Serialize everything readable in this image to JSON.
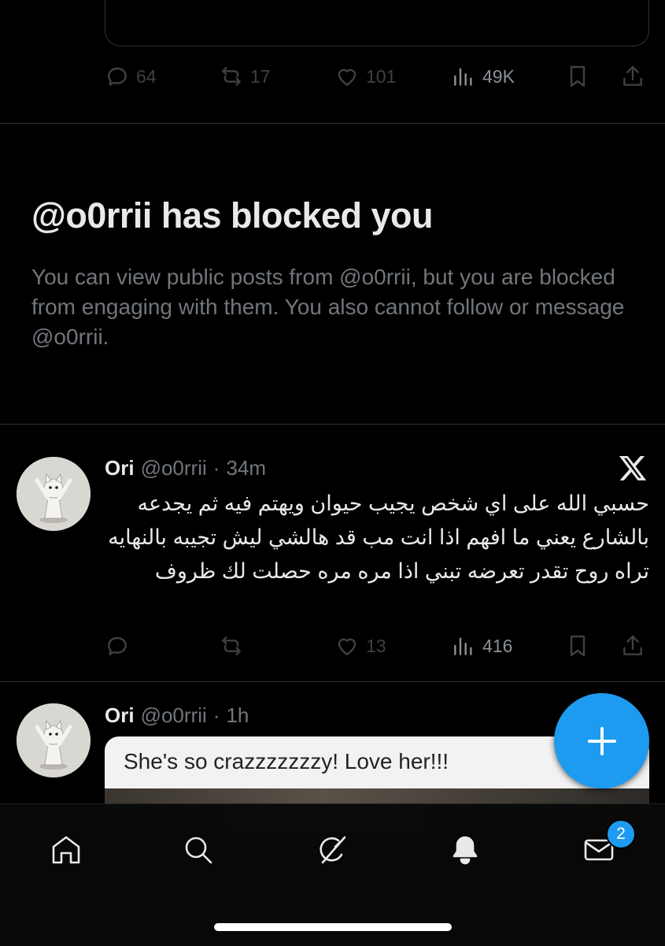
{
  "top_post": {
    "actions": {
      "reply": "64",
      "repost": "17",
      "like": "101",
      "views": "49K"
    }
  },
  "blocked": {
    "title": "@o0rrii has blocked you",
    "message": "You can view public posts from @o0rrii, but you are blocked from engaging with them. You also cannot follow or message @o0rrii."
  },
  "posts": [
    {
      "name": "Ori",
      "handle": "@o0rrii",
      "time": "34m",
      "text": "حسبي الله على اي شخص يجيب حيوان ويهتم فيه ثم يجدعه بالشارع يعني ما افهم اذا انت مب قد هالشي ليش تجيبه بالنهايه تراه روح تقدر تعرضه تبني اذا مره مره حصلت لك ظروف",
      "actions": {
        "reply": "",
        "repost": "",
        "like": "13",
        "views": "416"
      }
    },
    {
      "name": "Ori",
      "handle": "@o0rrii",
      "time": "1h",
      "media_caption": "She's so crazzzzzzzy! Love her!!!"
    }
  ],
  "separator": "·",
  "nav": {
    "items": [
      "home-icon",
      "search-icon",
      "grok-icon",
      "notifications-icon",
      "messages-icon"
    ],
    "messages_badge": "2"
  },
  "colors": {
    "accent": "#1d9bf0",
    "background": "#000000",
    "muted": "#71767b",
    "text": "#e7e9ea"
  }
}
